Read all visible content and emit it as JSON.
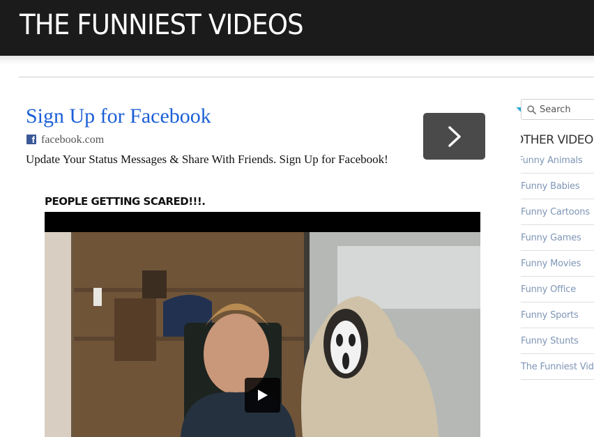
{
  "header": {
    "site_title": "THE FUNNIEST VIDEOS"
  },
  "ad": {
    "title": "Sign Up for Facebook",
    "domain": "facebook.com",
    "description": "Update Your Status Messages & Share With Friends. Sign Up for Facebook!"
  },
  "video": {
    "title": "PEOPLE GETTING SCARED!!!."
  },
  "sidebar": {
    "search_placeholder": "Search",
    "widget_title": "OTHER VIDEOS",
    "categories": [
      {
        "label": "Funny Animals"
      },
      {
        "label": "Funny Babies"
      },
      {
        "label": "Funny Cartoons"
      },
      {
        "label": "Funny Games"
      },
      {
        "label": "Funny Movies"
      },
      {
        "label": "Funny Office"
      },
      {
        "label": "Funny Sports"
      },
      {
        "label": "Funny Stunts"
      },
      {
        "label": "The Funniest Videos"
      }
    ]
  },
  "colors": {
    "header_bg": "#1b1b1b",
    "ad_link": "#1a5fd6",
    "sidebar_link": "#7e95b5"
  }
}
